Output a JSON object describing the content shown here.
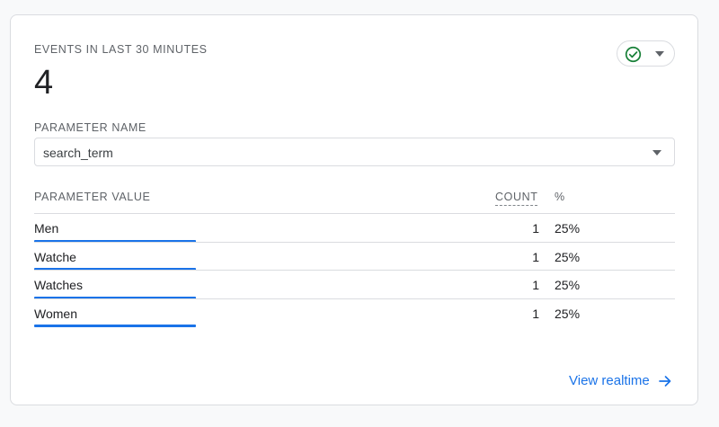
{
  "card": {
    "metric_label": "EVENTS IN LAST 30 MINUTES",
    "metric_value": "4",
    "status_icon": "check-circle-icon",
    "colors": {
      "accent": "#1a73e8",
      "success": "#188038"
    }
  },
  "parameter": {
    "label": "PARAMETER NAME",
    "selected": "search_term"
  },
  "table": {
    "headers": {
      "value": "PARAMETER VALUE",
      "count": "COUNT",
      "percent": "%"
    },
    "rows": [
      {
        "name": "Men",
        "count": "1",
        "percent": "25%",
        "share": 0.25
      },
      {
        "name": "Watche",
        "count": "1",
        "percent": "25%",
        "share": 0.25
      },
      {
        "name": "Watches",
        "count": "1",
        "percent": "25%",
        "share": 0.25
      },
      {
        "name": "Women",
        "count": "1",
        "percent": "25%",
        "share": 0.25
      }
    ]
  },
  "footer": {
    "link_label": "View realtime"
  }
}
